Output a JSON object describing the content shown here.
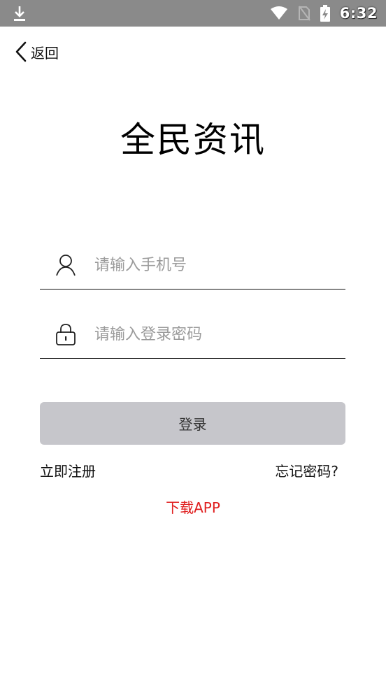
{
  "status_bar": {
    "time": "6:32",
    "icons": [
      "download-icon",
      "wifi-icon",
      "no-sim-icon",
      "battery-charging-icon"
    ]
  },
  "nav": {
    "back_label": "返回"
  },
  "app_title": "全民资讯",
  "form": {
    "phone_placeholder": "请输入手机号",
    "password_placeholder": "请输入登录密码",
    "login_label": "登录"
  },
  "links": {
    "register": "立即注册",
    "forgot_password": "忘记密码?",
    "download_app": "下载APP"
  },
  "colors": {
    "status_bar": "#8a8a8a",
    "login_button": "#c6c6cb",
    "download_link": "#e02020"
  }
}
